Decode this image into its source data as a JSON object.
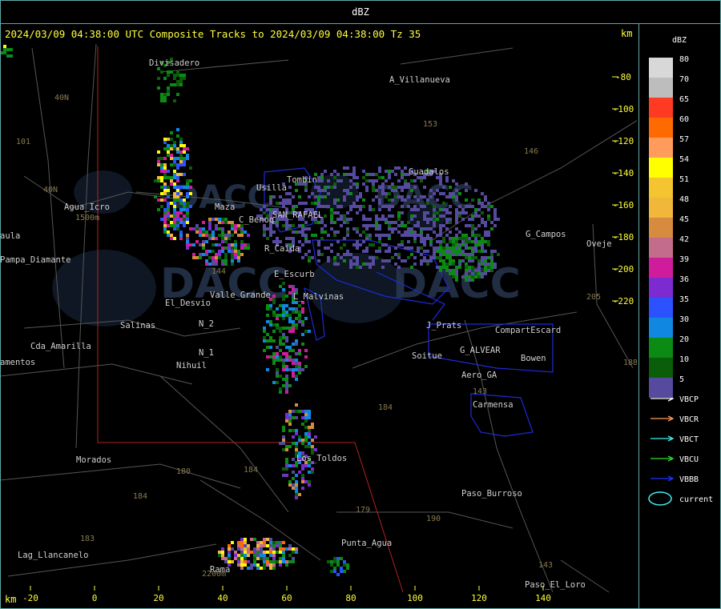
{
  "header": {
    "title": "dBZ"
  },
  "map": {
    "title": "2024/03/09 04:38:00 UTC Composite Tracks to 2024/03/09 04:38:00 Tz 35",
    "unit_top_right": "km",
    "unit_bottom_left": "km",
    "x_ticks": [
      "-20",
      "0",
      "20",
      "40",
      "60",
      "80",
      "100",
      "120",
      "140"
    ],
    "y_ticks": [
      "-80",
      "-100",
      "-120",
      "-140",
      "-160",
      "-180",
      "-200",
      "-220"
    ],
    "places": [
      {
        "name": "Divisadero"
      },
      {
        "name": "A_Villanueva"
      },
      {
        "name": "Usilla"
      },
      {
        "name": "Tombin"
      },
      {
        "name": "Guadalos"
      },
      {
        "name": "Agua_Icro"
      },
      {
        "name": "Maza"
      },
      {
        "name": "C_Benoq"
      },
      {
        "name": "SAN_RAFAEL"
      },
      {
        "name": "G_Campos"
      },
      {
        "name": "aula"
      },
      {
        "name": "Oveje"
      },
      {
        "name": "Pampa_Diamante"
      },
      {
        "name": "R_Caida"
      },
      {
        "name": "E_Escurb"
      },
      {
        "name": "El_Desvio"
      },
      {
        "name": "Valle_Grande"
      },
      {
        "name": "L_Malvinas"
      },
      {
        "name": "Salinas"
      },
      {
        "name": "N_2"
      },
      {
        "name": "J_Prats"
      },
      {
        "name": "CompartEscard"
      },
      {
        "name": "Cda_Amarilla"
      },
      {
        "name": "N_1"
      },
      {
        "name": "G_ALVEAR"
      },
      {
        "name": "amentos"
      },
      {
        "name": "Nihuil"
      },
      {
        "name": "Soitue"
      },
      {
        "name": "Bowen"
      },
      {
        "name": "Aero_GA"
      },
      {
        "name": "Carmensa"
      },
      {
        "name": "Los_Toldos"
      },
      {
        "name": "Morados"
      },
      {
        "name": "Paso_Burroso"
      },
      {
        "name": "Punta_Agua"
      },
      {
        "name": "Lag_Llancanelo"
      },
      {
        "name": "Paso_El_Loro"
      },
      {
        "name": "Rama"
      }
    ],
    "route_numbers": [
      "40N",
      "101",
      "153",
      "146",
      "144",
      "40N",
      "143",
      "184",
      "188",
      "205",
      "180",
      "184",
      "179",
      "190",
      "184",
      "183",
      "143",
      "2200m",
      "1500m"
    ],
    "watermark": "DACC"
  },
  "legend": {
    "title": "dBZ",
    "bins": [
      {
        "value": "80",
        "color": "#d8d8d8"
      },
      {
        "value": "70",
        "color": "#bdbdbd"
      },
      {
        "value": "65",
        "color": "#ff3a22"
      },
      {
        "value": "60",
        "color": "#ff6a00"
      },
      {
        "value": "57",
        "color": "#ff9c5c"
      },
      {
        "value": "54",
        "color": "#ffff00"
      },
      {
        "value": "51",
        "color": "#f5c431"
      },
      {
        "value": "48",
        "color": "#f1b73a"
      },
      {
        "value": "45",
        "color": "#d68b3e"
      },
      {
        "value": "42",
        "color": "#c36c8c"
      },
      {
        "value": "39",
        "color": "#cf1c9c"
      },
      {
        "value": "36",
        "color": "#7c2bd1"
      },
      {
        "value": "35",
        "color": "#2c52ff"
      },
      {
        "value": "30",
        "color": "#1087e0"
      },
      {
        "value": "20",
        "color": "#0b8a14"
      },
      {
        "value": "10",
        "color": "#0a5e0a"
      },
      {
        "value": "5",
        "color": "#554a9e"
      }
    ],
    "tracks": [
      {
        "label": "VBCP",
        "color": "#ffffff"
      },
      {
        "label": "VBCR",
        "color": "#ff9c5c"
      },
      {
        "label": "VBCT",
        "color": "#3ff0f0"
      },
      {
        "label": "VBCU",
        "color": "#30e030"
      },
      {
        "label": "VBBB",
        "color": "#2233ff"
      }
    ],
    "current_label": "current",
    "current_color": "#3ff0f0"
  }
}
